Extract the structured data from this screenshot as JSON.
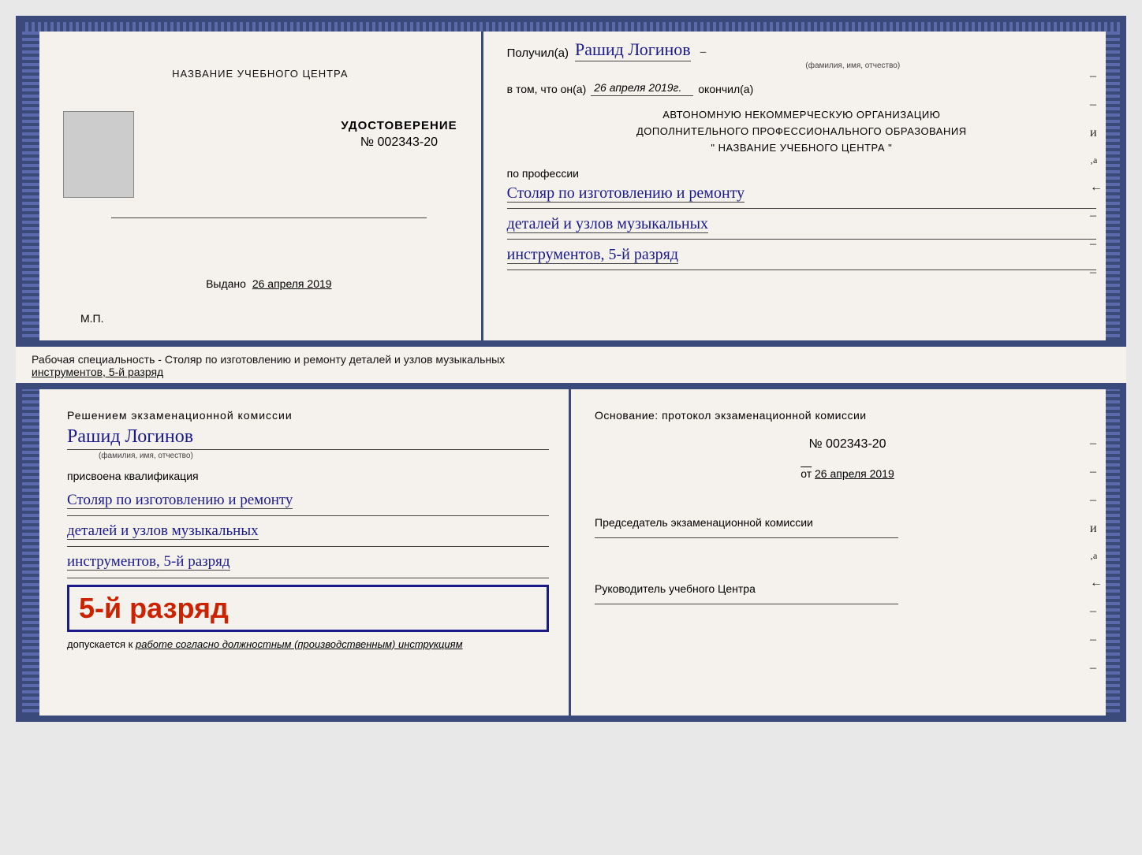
{
  "top_cert": {
    "left": {
      "title": "НАЗВАНИЕ УЧЕБНОГО ЦЕНТРА",
      "udostoverenie_label": "УДОСТОВЕРЕНИЕ",
      "nomer": "№ 002343-20",
      "vydano_label": "Выдано",
      "vydano_date": "26 апреля 2019",
      "mp": "М.П."
    },
    "right": {
      "poluchil_prefix": "Получил(а)",
      "poluchil_name": "Рашид Логинов",
      "fio_label": "(фамилия, имя, отчество)",
      "vtom_prefix": "в том, что он(а)",
      "vtom_date": "26 апреля 2019г.",
      "okonchil": "окончил(а)",
      "avtonom_line1": "АВТОНОМНУЮ НЕКОММЕРЧЕСКУЮ ОРГАНИЗАЦИЮ",
      "avtonom_line2": "ДОПОЛНИТЕЛЬНОГО ПРОФЕССИОНАЛЬНОГО ОБРАЗОВАНИЯ",
      "avtonom_name": "\"   НАЗВАНИЕ УЧЕБНОГО ЦЕНТРА   \"",
      "po_professii": "по профессии",
      "profession_line1": "Столяр по изготовлению и ремонту",
      "profession_line2": "деталей и узлов музыкальных",
      "profession_line3": "инструментов, 5-й разряд"
    }
  },
  "middle": {
    "text": "Рабочая специальность - Столяр по изготовлению и ремонту деталей и узлов музыкальных",
    "text2": "инструментов, 5-й разряд"
  },
  "bottom_cert": {
    "left": {
      "resheniem": "Решением экзаменационной комиссии",
      "name": "Рашид Логинов",
      "fio_label": "(фамилия, имя, отчество)",
      "prisvoena": "присвоена квалификация",
      "profession_line1": "Столяр по изготовлению и ремонту",
      "profession_line2": "деталей и узлов музыкальных",
      "profession_line3": "инструментов, 5-й разряд",
      "razryad_big": "5-й разряд",
      "dopuskaetsya_prefix": "допускается к",
      "dopuskaetsya_text": "работе согласно должностным (производственным) инструкциям"
    },
    "right": {
      "osnovanie": "Основание: протокол экзаменационной комиссии",
      "nomer": "№  002343-20",
      "ot_prefix": "от",
      "ot_date": "26 апреля 2019",
      "predsedatel_label": "Председатель экзаменационной комиссии",
      "rukovoditel_label": "Руководитель учебного Центра"
    }
  }
}
